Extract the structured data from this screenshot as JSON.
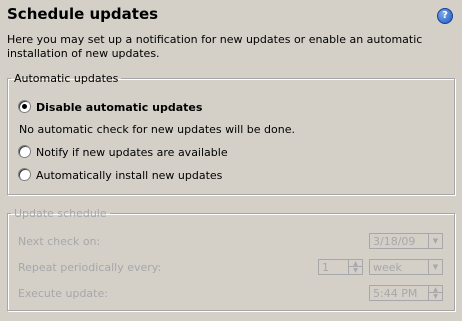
{
  "header": {
    "title": "Schedule updates",
    "intro": "Here you may set up a notification for new updates or enable an automatic installation of new updates."
  },
  "automatic_updates": {
    "legend": "Automatic updates",
    "options": [
      {
        "label": "Disable automatic updates",
        "selected": true
      },
      {
        "label": "Notify if new updates are available",
        "selected": false
      },
      {
        "label": "Automatically install new updates",
        "selected": false
      }
    ],
    "description": "No automatic check for new updates will be done."
  },
  "update_schedule": {
    "legend": "Update schedule",
    "next_check_label": "Next check on:",
    "next_check_value": "3/18/09",
    "repeat_label": "Repeat periodically every:",
    "repeat_count": "1",
    "repeat_unit": "week",
    "execute_label": "Execute update:",
    "execute_time": "5:44 PM"
  },
  "icons": {
    "help": "help-icon",
    "dropdown": "chevron-down-icon",
    "spin": "spin-arrows-icon"
  }
}
